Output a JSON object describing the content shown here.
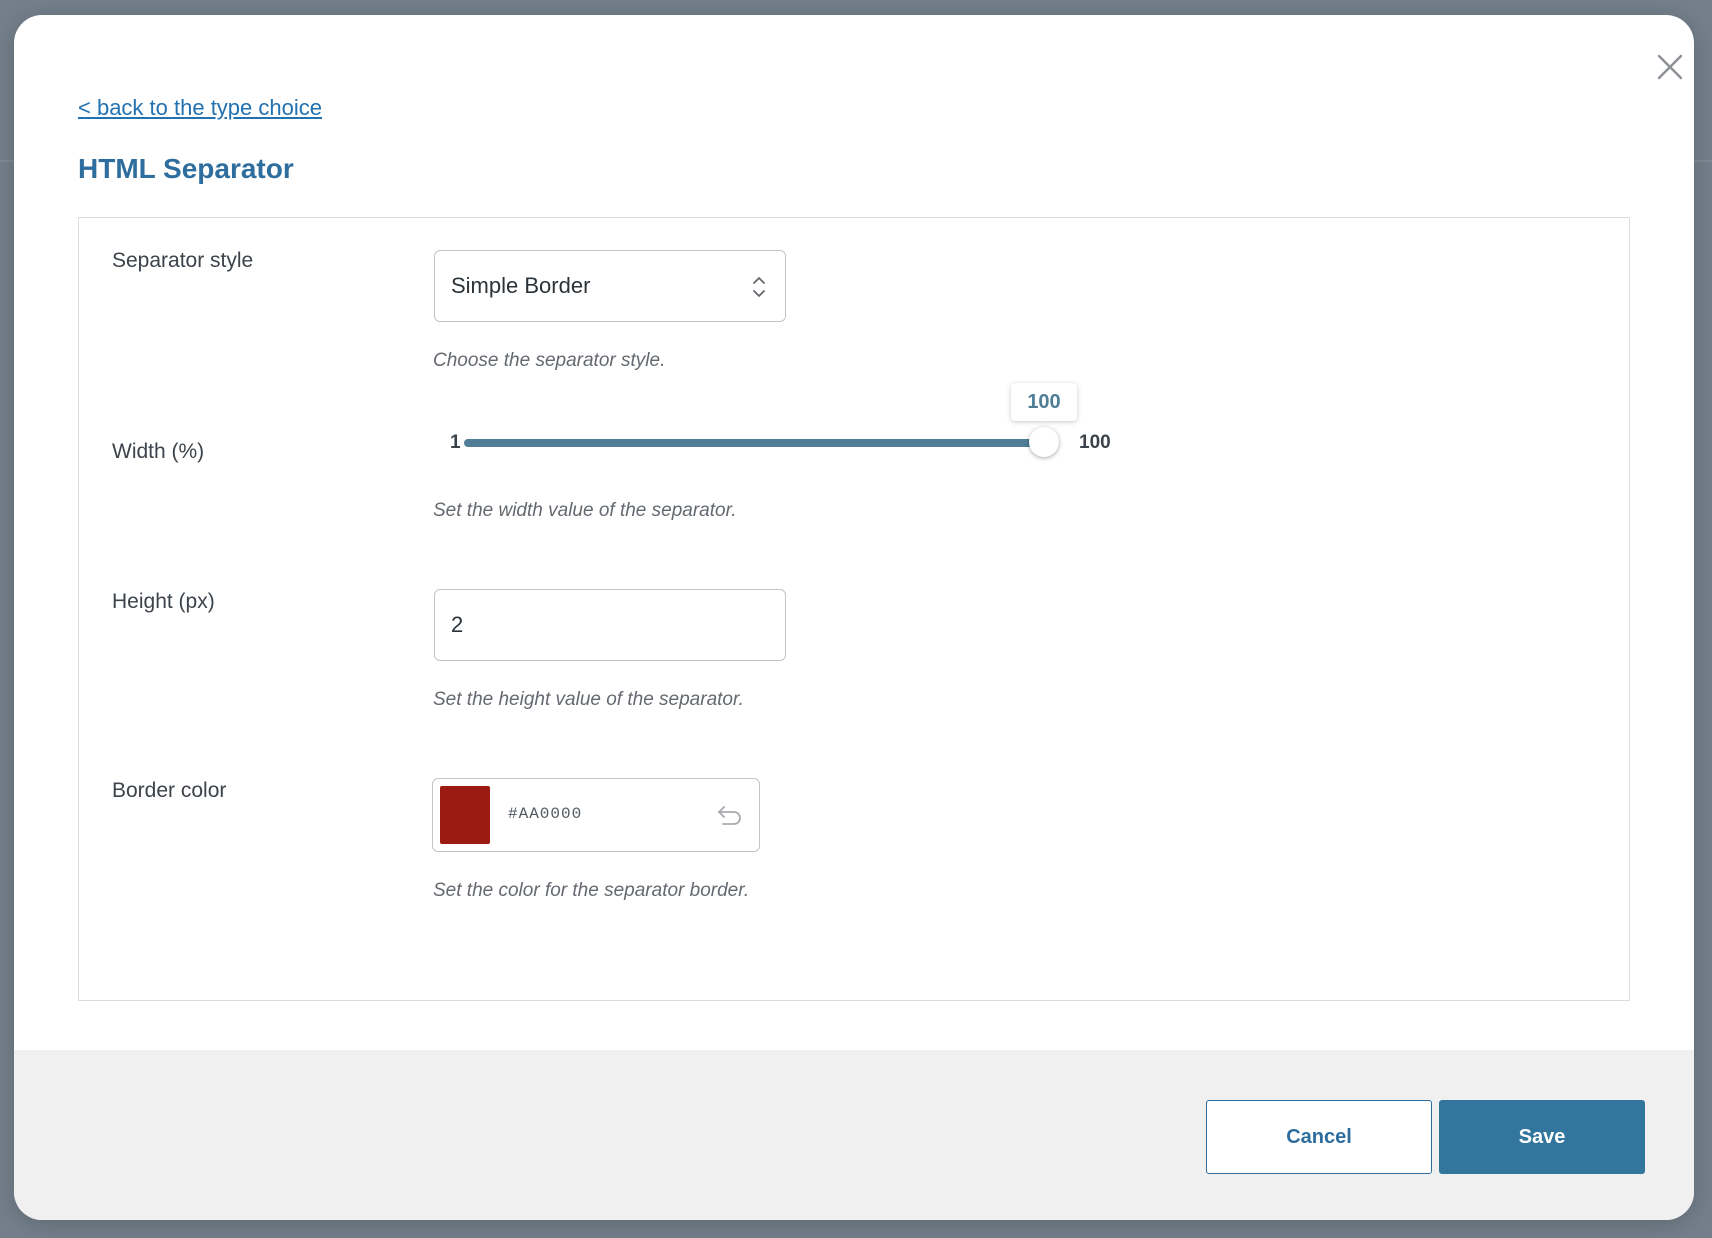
{
  "modal": {
    "back_link": "< back to the type choice",
    "title": "HTML Separator",
    "close_icon": "close-icon"
  },
  "fields": {
    "separator_style": {
      "label": "Separator style",
      "value": "Simple Border",
      "description": "Choose the separator style."
    },
    "width": {
      "label": "Width (%)",
      "min": "1",
      "max": "100",
      "value": "100",
      "fraction": 1.0,
      "description": "Set the width value of the separator."
    },
    "height": {
      "label": "Height (px)",
      "value": "2",
      "description": "Set the height value of the separator."
    },
    "border_color": {
      "label": "Border color",
      "value": "#AA0000",
      "swatch_color": "#9b1b13",
      "description": "Set the color for the separator border."
    }
  },
  "footer": {
    "cancel_label": "Cancel",
    "save_label": "Save"
  },
  "colors": {
    "accent": "#32769e",
    "link": "#2271b1"
  }
}
